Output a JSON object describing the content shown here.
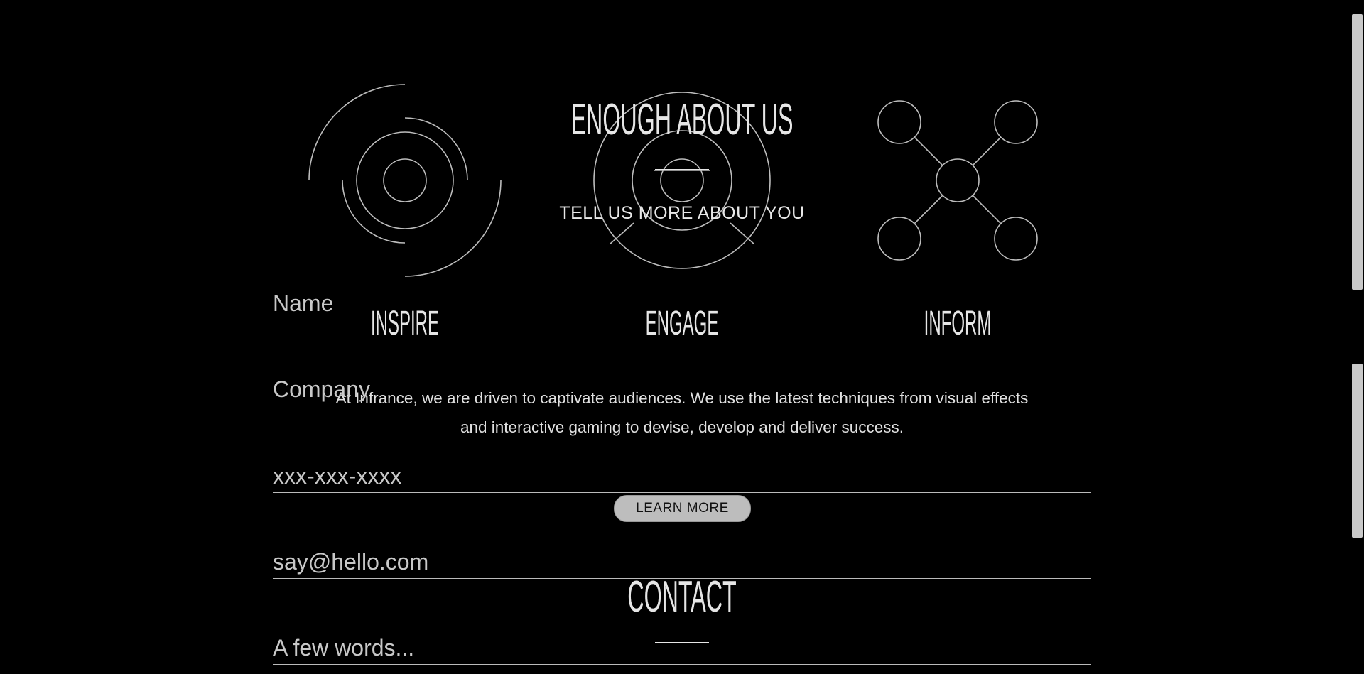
{
  "about": {
    "heading": "ENOUGH ABOUT US",
    "subheading": "TELL US MORE ABOUT YOU",
    "pillars": [
      {
        "label": "INSPIRE",
        "icon": "concentric-rings-icon"
      },
      {
        "label": "ENGAGE",
        "icon": "target-circle-icon"
      },
      {
        "label": "INFORM",
        "icon": "network-nodes-icon"
      }
    ],
    "text_line1": "At Infrance, we are driven to captivate audiences. We use the latest techniques from visual effects",
    "text_line2": "and interactive gaming to devise, develop and deliver success.",
    "learn_more_label": "LEARN MORE"
  },
  "contact": {
    "heading": "CONTACT",
    "fields": [
      {
        "placeholder": "Name",
        "value": ""
      },
      {
        "placeholder": "Company",
        "value": ""
      },
      {
        "placeholder": "xxx-xxx-xxxx",
        "value": ""
      },
      {
        "placeholder": "say@hello.com",
        "value": ""
      },
      {
        "placeholder": "A few words...",
        "value": ""
      }
    ]
  },
  "colors": {
    "background": "#000000",
    "foreground": "#e6e6e6",
    "line": "#bbbbbb",
    "button": "#bdbdbd"
  }
}
